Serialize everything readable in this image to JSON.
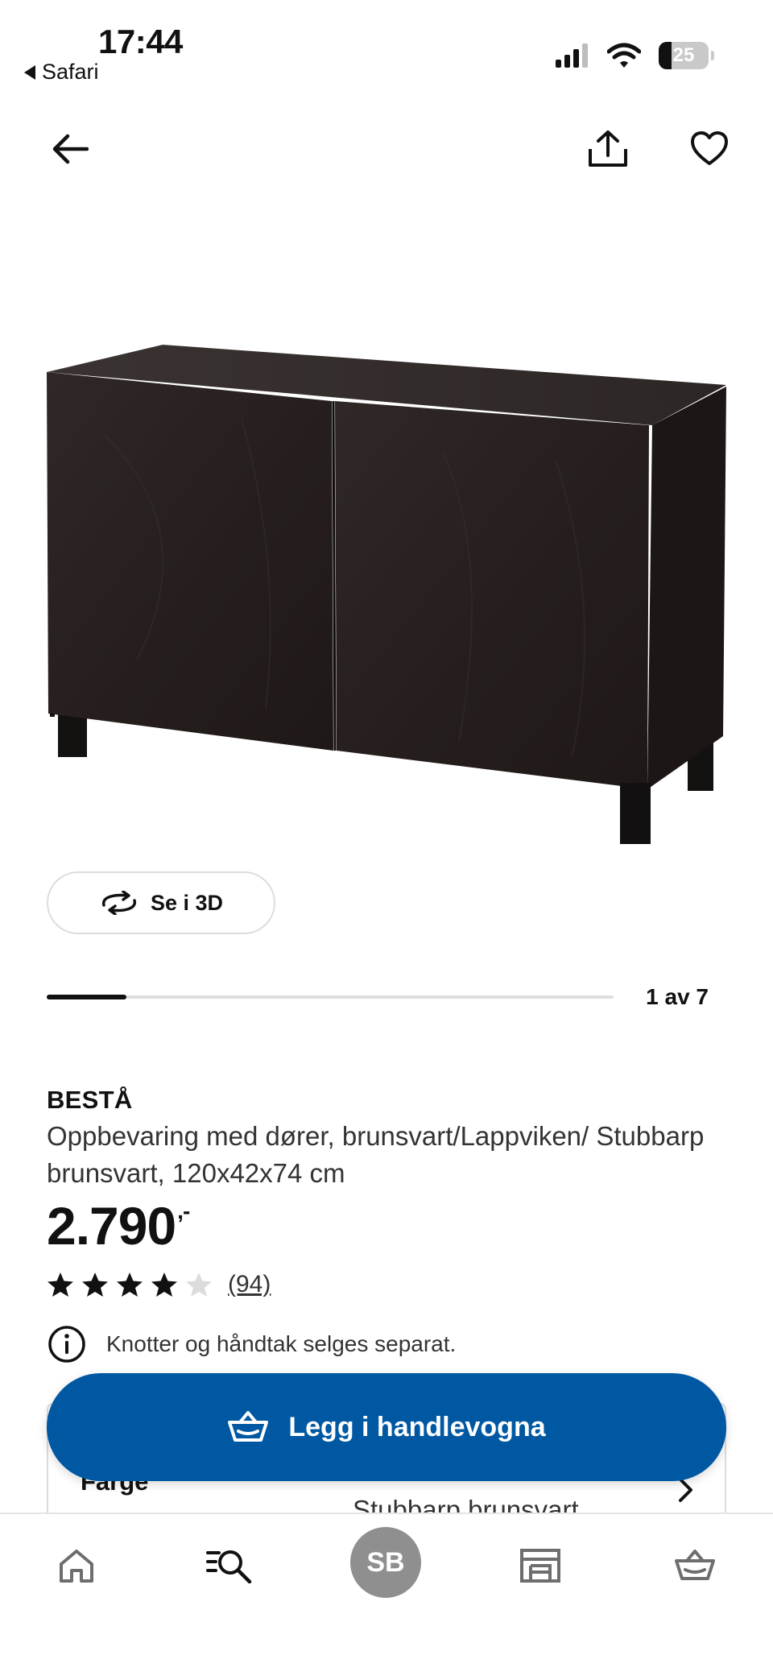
{
  "status_bar": {
    "time": "17:44",
    "back_app": "Safari",
    "battery": "25"
  },
  "product": {
    "see_3d_label": "Se i 3D",
    "image_counter": "1 av 7",
    "image_progress": 0.14,
    "brand": "BESTÅ",
    "description": "Oppbevaring med dører, brunsvart/Lappviken/ Stubbarp brunsvart, 120x42x74 cm",
    "price": "2.790",
    "price_suffix": ",-",
    "rating_stars": 4,
    "rating_max": 5,
    "review_count": "(94)",
    "info_note": "Knotter og håndtak selges separat."
  },
  "option": {
    "label": "Farge",
    "value": "Stubbarp brunsvart"
  },
  "cart_button_label": "Legg i handlevogna",
  "nav": {
    "avatar_initials": "SB"
  },
  "colors": {
    "ikea_blue": "#0058a3",
    "cabinet": "#2a2321"
  }
}
